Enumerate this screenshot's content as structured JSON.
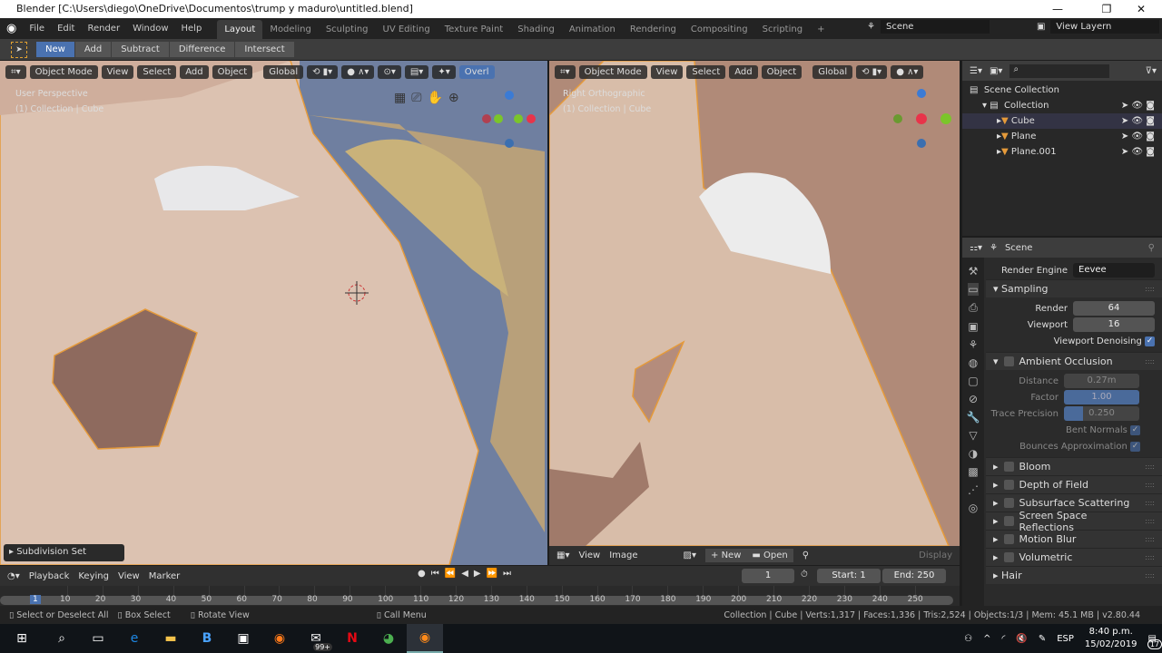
{
  "window": {
    "title": "Blender [C:\\Users\\diego\\OneDrive\\Documentos\\trump y maduro\\untitled.blend]",
    "min": "—",
    "max": "❐",
    "close": "✕"
  },
  "menu": [
    "File",
    "Edit",
    "Render",
    "Window",
    "Help"
  ],
  "workspaces": [
    "Layout",
    "Modeling",
    "Sculpting",
    "UV Editing",
    "Texture Paint",
    "Shading",
    "Animation",
    "Rendering",
    "Compositing",
    "Scripting",
    "+"
  ],
  "scene": {
    "label": "Scene",
    "view_layer": "View Layern"
  },
  "tool_modes": [
    "New",
    "Add",
    "Subtract",
    "Difference",
    "Intersect"
  ],
  "viewport_left": {
    "mode": "Object Mode",
    "menus": [
      "View",
      "Select",
      "Add",
      "Object"
    ],
    "orientation": "Global",
    "overlay": "Overl",
    "perspective": "User Perspective",
    "collection": "(1) Collection | Cube",
    "last_op": "Subdivision Set"
  },
  "viewport_right": {
    "mode": "Object Mode",
    "menus": [
      "View",
      "Select",
      "Add",
      "Object"
    ],
    "orientation": "Global",
    "perspective": "Right Orthographic",
    "collection": "(1) Collection | Cube"
  },
  "image_editor": {
    "menus": [
      "View",
      "Image"
    ],
    "new": "New",
    "open": "Open",
    "display": "Display"
  },
  "outliner": {
    "root": "Scene Collection",
    "collection": "Collection",
    "items": [
      "Cube",
      "Plane",
      "Plane.001"
    ]
  },
  "properties": {
    "context": "Scene",
    "render_engine_label": "Render Engine",
    "render_engine": "Eevee",
    "sampling": {
      "title": "Sampling",
      "render_label": "Render",
      "render": "64",
      "viewport_label": "Viewport",
      "viewport": "16",
      "denoise": "Viewport Denoising"
    },
    "ao": {
      "title": "Ambient Occlusion",
      "distance_label": "Distance",
      "distance": "0.27m",
      "factor_label": "Factor",
      "factor": "1.00",
      "trace_label": "Trace Precision",
      "trace": "0.250",
      "trace_fraction": 0.25,
      "bent": "Bent Normals",
      "bounces": "Bounces Approximation"
    },
    "sections": [
      "Bloom",
      "Depth of Field",
      "Subsurface Scattering",
      "Screen Space Reflections",
      "Motion Blur",
      "Volumetric"
    ],
    "hair": "Hair"
  },
  "timeline": {
    "menus": [
      "Playback",
      "Keying",
      "View",
      "Marker"
    ],
    "current": "1",
    "start_label": "Start:",
    "start": "1",
    "end_label": "End:",
    "end": "250",
    "ticks": [
      10,
      20,
      30,
      40,
      50,
      60,
      70,
      80,
      90,
      100,
      110,
      120,
      130,
      140,
      150,
      160,
      170,
      180,
      190,
      200,
      210,
      220,
      230,
      240,
      250
    ],
    "frame_marker": "1"
  },
  "status": {
    "hint1": "Select or Deselect All",
    "hint2": "Box Select",
    "hint3": "Rotate View",
    "hint4": "Call Menu",
    "stats": "Collection | Cube | Verts:1,317 | Faces:1,336 | Tris:2,524 | Objects:1/3 | Mem: 45.1 MB | v2.80.44"
  },
  "taskbar": {
    "badge": "99+",
    "lang": "ESP",
    "time": "8:40 p.m.",
    "date": "15/02/2019",
    "notif": "17"
  }
}
